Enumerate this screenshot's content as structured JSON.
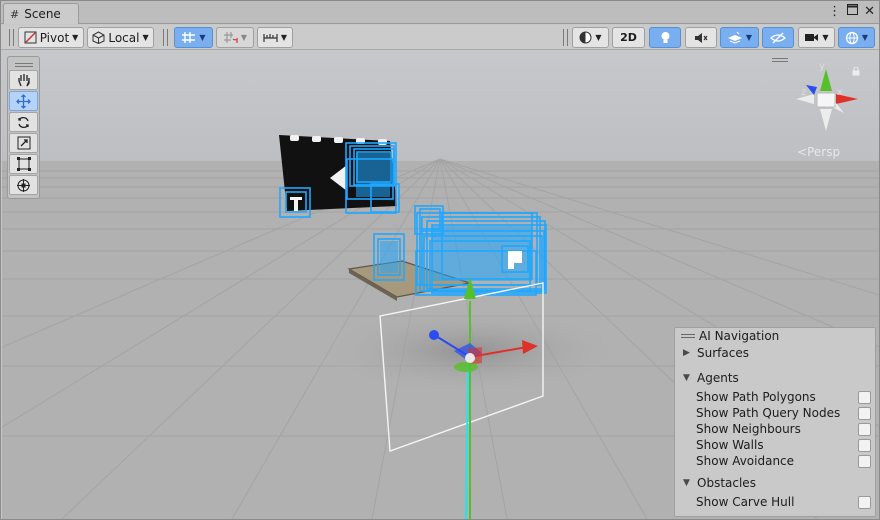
{
  "tab": {
    "title": "Scene"
  },
  "toolbar": {
    "pivot_label": "Pivot",
    "local_label": "Local",
    "mode_2d_label": "2D"
  },
  "viewport": {
    "projection_label": "Persp",
    "axes": {
      "y": "y",
      "z": "z",
      "x": "x"
    }
  },
  "ai_navigation": {
    "title": "AI Navigation",
    "sections": [
      {
        "label": "Surfaces",
        "expanded": false,
        "items": []
      },
      {
        "label": "Agents",
        "expanded": true,
        "items": [
          "Show Path Polygons",
          "Show Path Query Nodes",
          "Show Neighbours",
          "Show Walls",
          "Show Avoidance"
        ]
      },
      {
        "label": "Obstacles",
        "expanded": true,
        "items": [
          "Show Carve Hull"
        ]
      }
    ]
  },
  "colors": {
    "selection_blue": "#1ea7ff",
    "x_axis": "#e0302a",
    "y_axis": "#56c02b",
    "z_axis": "#2a4cf0",
    "toolbar_active": "#79aef0"
  },
  "icons": {
    "tab": "hash-icon",
    "menu": "kebab-menu-icon",
    "maximize": "maximize-icon",
    "close": "close-icon"
  }
}
